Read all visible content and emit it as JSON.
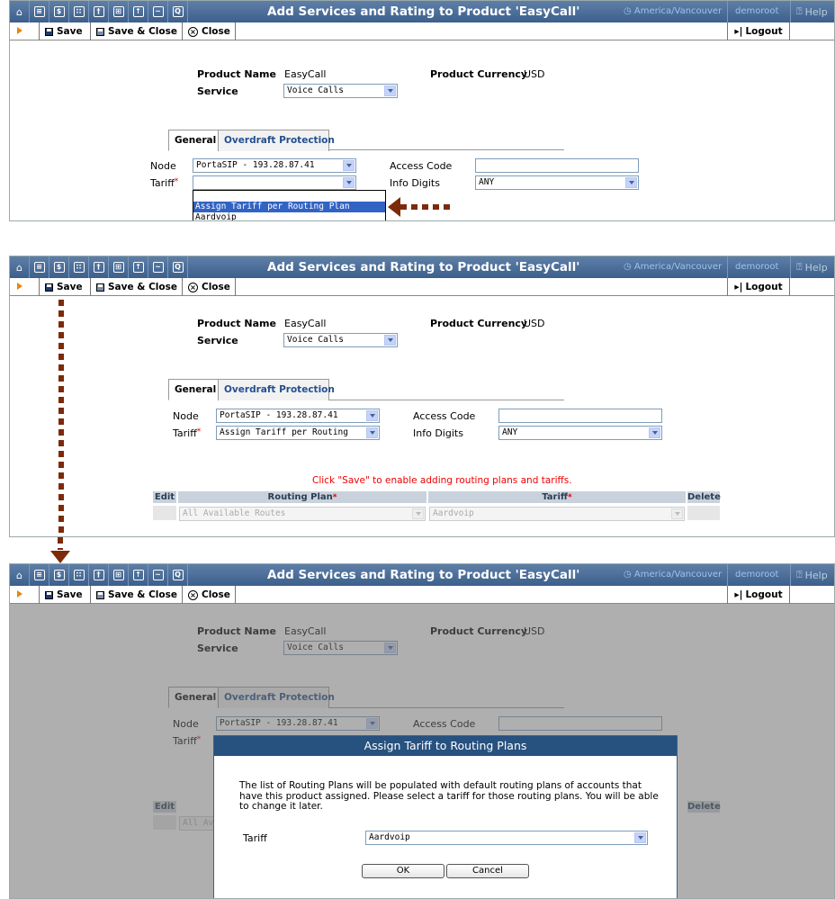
{
  "window": {
    "title": "Add Services and Rating to Product 'EasyCall'",
    "timezone": "America/Vancouver",
    "user": "demoroot",
    "help_label": "Help"
  },
  "toolbar": {
    "save_label": "Save",
    "save_close_label": "Save & Close",
    "close_label": "Close",
    "logout_label": "Logout"
  },
  "product": {
    "name_label": "Product Name",
    "name_value": "EasyCall",
    "currency_label": "Product Currency",
    "currency_value": "USD",
    "service_label": "Service",
    "service_value": "Voice Calls"
  },
  "tabs": {
    "general": "General",
    "overdraft": "Overdraft Protection"
  },
  "form": {
    "node_label": "Node",
    "node_value": "PortaSIP - 193.28.87.41",
    "tariff_label": "Tariff",
    "required_mark": "*",
    "access_code_label": "Access Code",
    "info_digits_label": "Info Digits",
    "info_digits_value": "ANY",
    "tariff_empty": "",
    "tariff_selected": "Assign Tariff per Routing"
  },
  "tariff_options": [
    "",
    "Assign Tariff per Routing Plan",
    "Aardvoip"
  ],
  "routing": {
    "notice": "Click \"Save\" to enable adding routing plans and tariffs.",
    "col_edit": "Edit",
    "col_routing_plan": "Routing Plan",
    "col_tariff": "Tariff",
    "col_delete": "Delete",
    "routing_plan_value": "All Available Routes",
    "tariff_value": "Aardvoip"
  },
  "dialog": {
    "title": "Assign Tariff to Routing Plans",
    "message": "The list of Routing Plans will be populated with default routing plans of accounts that have this product assigned. Please select a tariff for those routing plans. You will be able to change it later.",
    "tariff_label": "Tariff",
    "tariff_value": "Aardvoip",
    "ok_label": "OK",
    "cancel_label": "Cancel"
  },
  "icons": [
    "home-icon",
    "list-icon",
    "dollar-icon",
    "grid-icon",
    "person-icon",
    "network-icon",
    "upload-icon",
    "chart-icon",
    "search-icon"
  ],
  "colors": {
    "titlebar": "#3c5f8c",
    "annotation_arrow": "#7c2a0a",
    "highlight": "#3163c5",
    "notice": "#e00000"
  }
}
